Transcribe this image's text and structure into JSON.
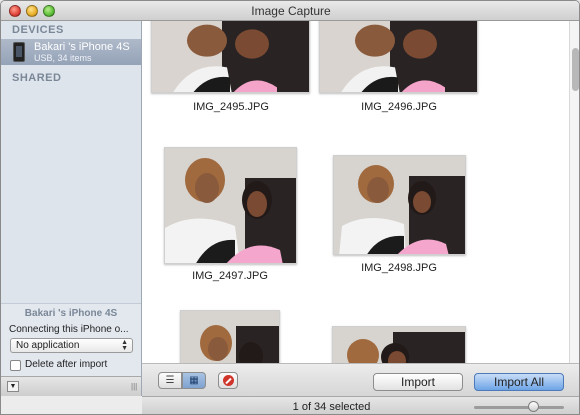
{
  "window": {
    "title": "Image Capture"
  },
  "sidebar": {
    "devices_heading": "DEVICES",
    "shared_heading": "SHARED",
    "device": {
      "name": "Bakari 's iPhone 4S",
      "subtitle": "USB, 34 items",
      "icon": "iphone-icon"
    },
    "settings": {
      "title": "Bakari 's iPhone 4S",
      "connect_label": "Connecting this iPhone o...",
      "app_select_value": "No application",
      "delete_after_import_label": "Delete after import",
      "delete_after_import_checked": false
    }
  },
  "photos": [
    {
      "name": "IMG_2495.JPG"
    },
    {
      "name": "IMG_2496.JPG"
    },
    {
      "name": "IMG_2497.JPG"
    },
    {
      "name": "IMG_2498.JPG"
    },
    {
      "name": ""
    },
    {
      "name": ""
    }
  ],
  "toolbar": {
    "list_view_icon": "list-icon",
    "grid_view_icon": "grid-icon",
    "delete_icon": "delete-icon",
    "import_label": "Import",
    "import_all_label": "Import All"
  },
  "status": {
    "selection_text": "1 of 34 selected",
    "thumbnail_size": 0.65
  },
  "colors": {
    "accent": "#6da4e6",
    "sidebar_bg": "#dee4ec",
    "selection": "#95a3b8"
  }
}
